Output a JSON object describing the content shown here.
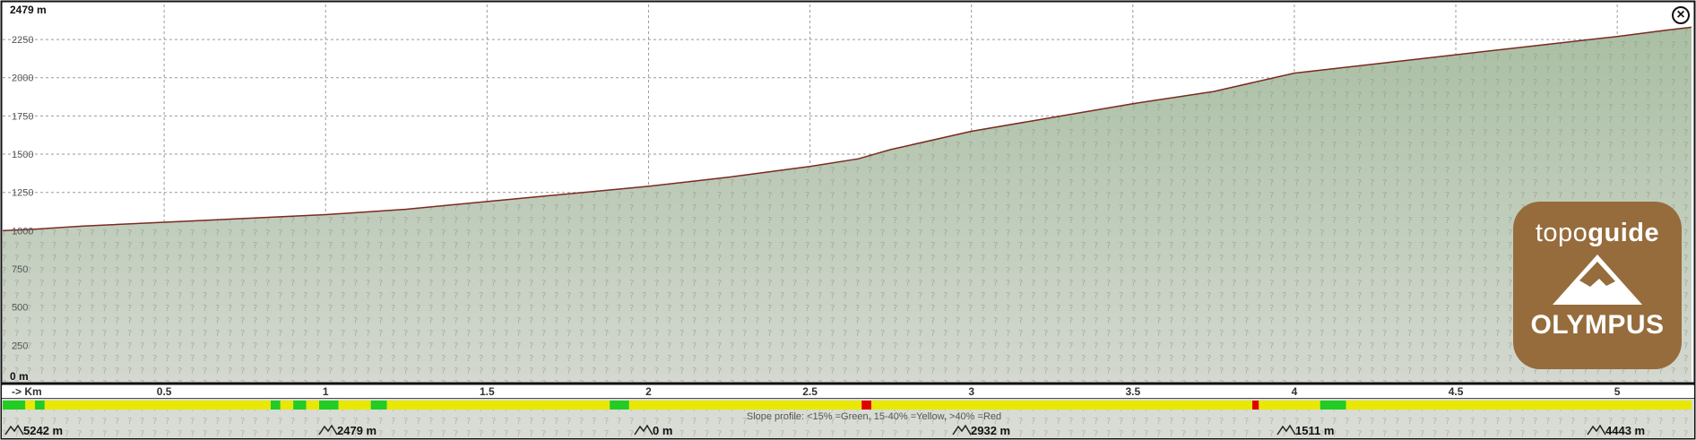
{
  "window": {
    "close_icon": "close-circle-icon",
    "close_glyph": "×"
  },
  "logo": {
    "brand_light": "topo",
    "brand_bold": "guide",
    "name": "OLYMPUS",
    "color": "#966c3c",
    "icon": "mountain-icon"
  },
  "colors": {
    "fill_top": "#a9bfa3",
    "fill_bottom": "#d4d8d0",
    "line": "#7a2a22",
    "green": "#22cc22",
    "yellow": "#e8e800",
    "red": "#e00000"
  },
  "chart_data": {
    "type": "area",
    "y_top_label": "2479 m",
    "y_bottom_label": "0 m",
    "yticks": [
      "250",
      "500",
      "750",
      "1000",
      "1250",
      "1500",
      "1750",
      "2000",
      "2250"
    ],
    "ylim": [
      0,
      2479
    ],
    "x_axis_label": "-> Km",
    "xticks": [
      "0.5",
      "1",
      "1.5",
      "2",
      "2.5",
      "3",
      "3.5",
      "4",
      "4.5",
      "5"
    ],
    "xlim": [
      0,
      5.23
    ],
    "grid": true,
    "x": [
      0,
      0.1,
      0.25,
      0.5,
      0.75,
      1.0,
      1.25,
      1.5,
      1.75,
      2.0,
      2.25,
      2.5,
      2.65,
      2.75,
      3.0,
      3.25,
      3.5,
      3.75,
      4.0,
      4.25,
      4.5,
      4.75,
      5.0,
      5.15,
      5.23
    ],
    "y": [
      1000,
      1010,
      1030,
      1055,
      1080,
      1105,
      1140,
      1190,
      1240,
      1290,
      1350,
      1420,
      1470,
      1530,
      1650,
      1740,
      1830,
      1910,
      2030,
      2090,
      2150,
      2210,
      2270,
      2310,
      2330
    ],
    "slope_profile": {
      "legend": "Slope profile: <15% =Green, 15-40% =Yellow, >40% =Red",
      "segments": [
        {
          "start": 0.0,
          "end": 0.07,
          "class": "green"
        },
        {
          "start": 0.07,
          "end": 0.1,
          "class": "yellow"
        },
        {
          "start": 0.1,
          "end": 0.13,
          "class": "green"
        },
        {
          "start": 0.13,
          "end": 0.83,
          "class": "yellow"
        },
        {
          "start": 0.83,
          "end": 0.86,
          "class": "green"
        },
        {
          "start": 0.86,
          "end": 0.9,
          "class": "yellow"
        },
        {
          "start": 0.9,
          "end": 0.94,
          "class": "green"
        },
        {
          "start": 0.94,
          "end": 0.98,
          "class": "yellow"
        },
        {
          "start": 0.98,
          "end": 1.04,
          "class": "green"
        },
        {
          "start": 1.04,
          "end": 1.14,
          "class": "yellow"
        },
        {
          "start": 1.14,
          "end": 1.19,
          "class": "green"
        },
        {
          "start": 1.19,
          "end": 1.88,
          "class": "yellow"
        },
        {
          "start": 1.88,
          "end": 1.94,
          "class": "green"
        },
        {
          "start": 1.94,
          "end": 2.66,
          "class": "yellow"
        },
        {
          "start": 2.66,
          "end": 2.69,
          "class": "red"
        },
        {
          "start": 2.69,
          "end": 3.87,
          "class": "yellow"
        },
        {
          "start": 3.87,
          "end": 3.89,
          "class": "red"
        },
        {
          "start": 3.89,
          "end": 4.08,
          "class": "yellow"
        },
        {
          "start": 4.08,
          "end": 4.16,
          "class": "green"
        },
        {
          "start": 4.16,
          "end": 5.23,
          "class": "yellow"
        }
      ]
    },
    "stats": [
      {
        "icon": "distance-icon",
        "value": "5242 m"
      },
      {
        "icon": "max-altitude-icon",
        "value": "2479 m"
      },
      {
        "icon": "min-altitude-icon",
        "value": "0 m"
      },
      {
        "icon": "ascent-icon",
        "value": "2932 m"
      },
      {
        "icon": "descent-icon",
        "value": "1511 m"
      },
      {
        "icon": "total-elevation-icon",
        "value": "4443 m"
      }
    ]
  }
}
